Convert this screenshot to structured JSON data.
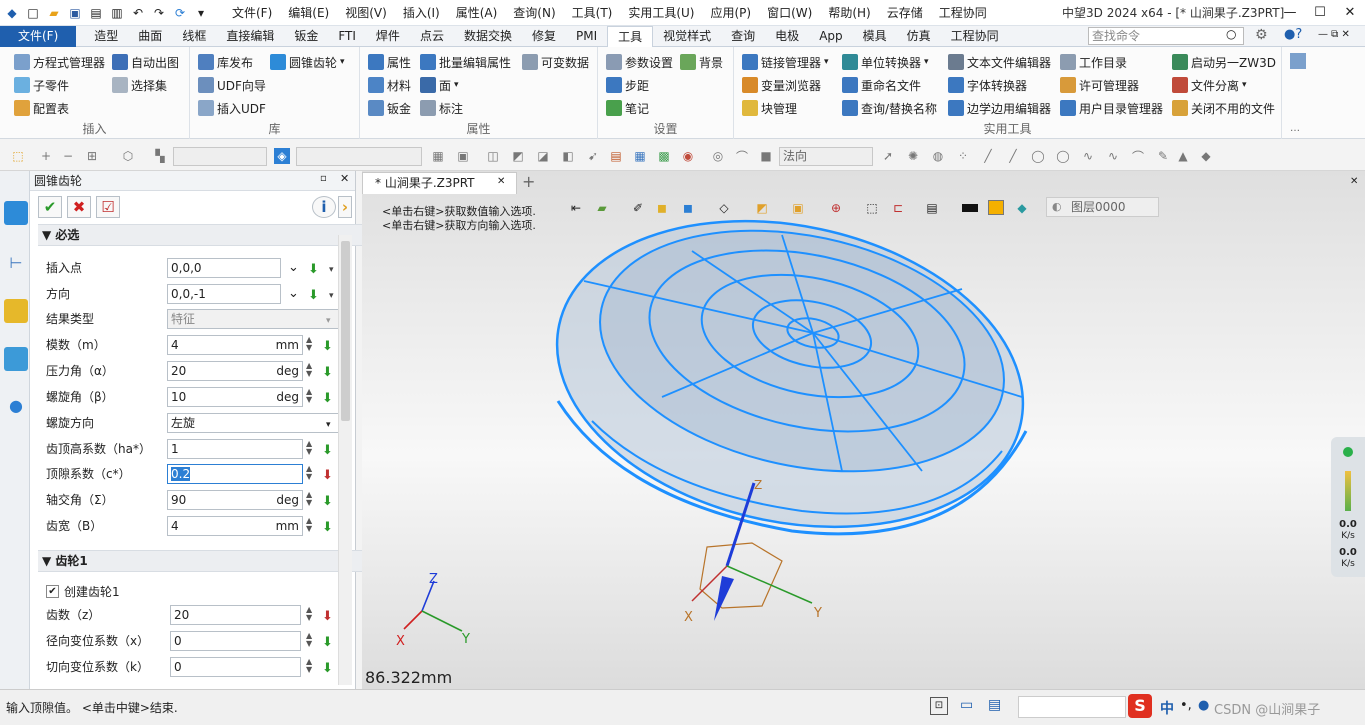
{
  "window": {
    "title": "中望3D 2024 x64 - [* 山涧果子.Z3PRT]"
  },
  "menu": [
    "文件(F)",
    "编辑(E)",
    "视图(V)",
    "插入(I)",
    "属性(A)",
    "查询(N)",
    "工具(T)",
    "实用工具(U)",
    "应用(P)",
    "窗口(W)",
    "帮助(H)",
    "云存储",
    "工程协同"
  ],
  "tabs": [
    "文件(F)",
    "造型",
    "曲面",
    "线框",
    "直接编辑",
    "钣金",
    "FTI",
    "焊件",
    "点云",
    "数据交换",
    "修复",
    "PMI",
    "工具",
    "视觉样式",
    "查询",
    "电极",
    "App",
    "模具",
    "仿真",
    "工程协同"
  ],
  "active_tab": "工具",
  "search_cmd": "查找命令",
  "ribbon": {
    "insert": {
      "label": "插入",
      "btns": [
        "方程式管理器",
        "自动出图",
        "子零件",
        "选择集",
        "配置表"
      ]
    },
    "library": {
      "label": "库",
      "btns": [
        "库发布",
        "圆锥齿轮",
        "UDF向导",
        "插入UDF"
      ]
    },
    "props": {
      "label": "属性",
      "btns": [
        "属性",
        "批量编辑属性",
        "可变数据",
        "材料",
        "面",
        "钣金",
        "标注"
      ]
    },
    "settings": {
      "label": "设置",
      "btns": [
        "参数设置",
        "背景",
        "步距",
        "笔记"
      ]
    },
    "utils": {
      "label": "实用工具",
      "btns": [
        "链接管理器",
        "单位转换器",
        "文本文件编辑器",
        "工作目录",
        "启动另一ZW3D",
        "变量浏览器",
        "重命名文件",
        "字体转换器",
        "许可管理器",
        "文件分离",
        "块管理",
        "查询/替换名称",
        "边学边用编辑器",
        "用户目录管理器",
        "关闭不用的文件"
      ]
    }
  },
  "toolbar2": {
    "combo3": "法向"
  },
  "panel": {
    "title": "圆锥齿轮",
    "sec_required": "必选",
    "rows": [
      {
        "label": "插入点",
        "value": "0,0,0"
      },
      {
        "label": "方向",
        "value": "0,0,-1"
      },
      {
        "label": "结果类型",
        "value": "特征"
      },
      {
        "label": "模数（m）",
        "value": "4",
        "unit": "mm"
      },
      {
        "label": "压力角（α）",
        "value": "20",
        "unit": "deg"
      },
      {
        "label": "螺旋角（β）",
        "value": "10",
        "unit": "deg"
      },
      {
        "label": "螺旋方向",
        "value": "左旋"
      },
      {
        "label": "齿顶高系数（ha*）",
        "value": "1"
      },
      {
        "label": "顶隙系数（c*）",
        "value": "0.2"
      },
      {
        "label": "轴交角（Σ）",
        "value": "90",
        "unit": "deg"
      },
      {
        "label": "齿宽（B）",
        "value": "4",
        "unit": "mm"
      }
    ],
    "sec_gear1": "齿轮1",
    "create_gear1": "创建齿轮1",
    "gear_rows": [
      {
        "label": "齿数（z）",
        "value": "20"
      },
      {
        "label": "径向变位系数（x）",
        "value": "0"
      },
      {
        "label": "切向变位系数（k）",
        "value": "0"
      }
    ]
  },
  "doc_tab": "* 山涧果子.Z3PRT",
  "hints": [
    "<单击右键>获取数值输入选项.",
    "<单击右键>获取方向输入选项."
  ],
  "layer": "图层0000",
  "measure": "86.322mm",
  "status": "输入顶隙值。 <单击中键>结束.",
  "net": {
    "up": "0.0",
    "up_unit": "K/s",
    "down": "0.0",
    "down_unit": "K/s"
  },
  "ime": "中",
  "watermark": "CSDN @山涧果子",
  "axis": {
    "x": "X",
    "y": "Y",
    "z": "Z"
  }
}
